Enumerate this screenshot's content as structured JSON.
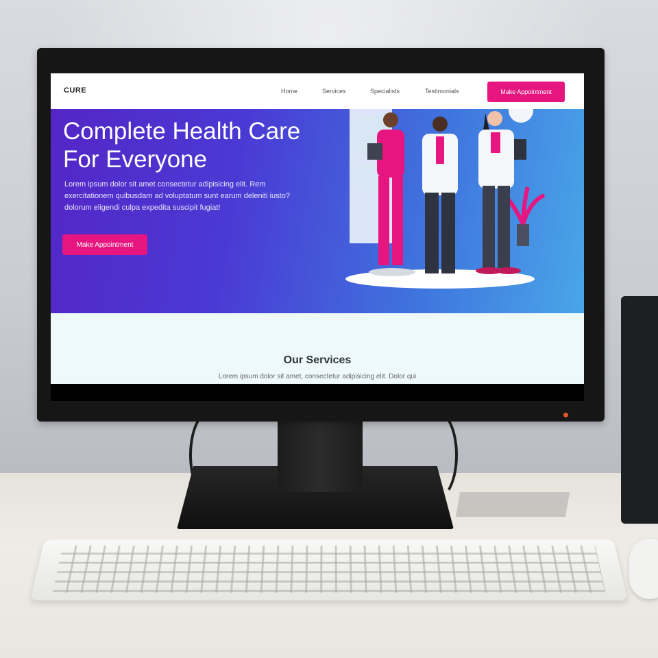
{
  "nav": {
    "logo": "CURE",
    "links": [
      "Home",
      "Services",
      "Specialists",
      "Testimonials"
    ],
    "cta": "Make Appointment"
  },
  "hero": {
    "title": "Complete Health Care For Everyone",
    "text": "Lorem ipsum dolor sit amet consectetur adipisicing elit. Rem exercitationem quibusdam ad voluptatum sunt earum deleniti iusto? dolorum eligendi culpa expedita suscipit fugiat!",
    "cta": "Make Appointment"
  },
  "services": {
    "title": "Our Services",
    "text": "Lorem ipsum dolor sit amet, consectetur adipisicing elit. Dolor qui"
  },
  "colors": {
    "accent": "#e6157f",
    "hero_start": "#5426c7",
    "hero_end": "#49a6e8"
  }
}
